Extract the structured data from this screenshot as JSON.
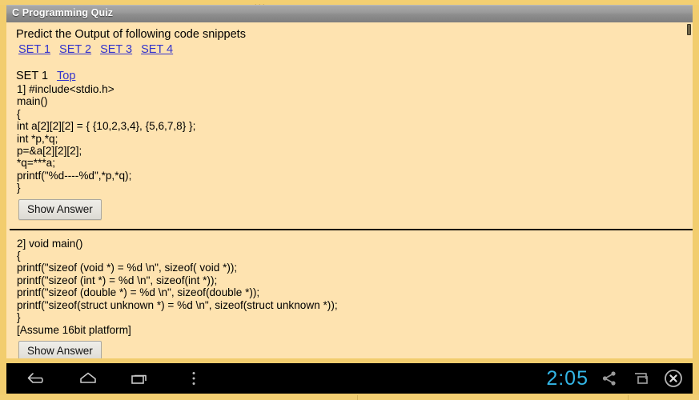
{
  "window": {
    "title": "C Programming Quiz"
  },
  "page": {
    "intro": "Predict the Output of following code snippets",
    "nav_links": [
      {
        "label": "SET 1"
      },
      {
        "label": "SET 2"
      },
      {
        "label": "SET 3"
      },
      {
        "label": "SET 4"
      }
    ],
    "sections": [
      {
        "heading": "SET 1",
        "top_link": "Top",
        "code": "1] #include<stdio.h>\nmain()\n{\nint a[2][2][2] = { {10,2,3,4}, {5,6,7,8} };\nint *p,*q;\np=&a[2][2][2];\n*q=***a;\nprintf(\"%d----%d\",*p,*q);\n}",
        "button_label": "Show Answer"
      },
      {
        "heading": "",
        "code": "2] void main()\n{\nprintf(\"sizeof (void *) = %d \\n\", sizeof( void *));\nprintf(\"sizeof (int *) = %d \\n\", sizeof(int *));\nprintf(\"sizeof (double *) = %d \\n\", sizeof(double *));\nprintf(\"sizeof(struct unknown *) = %d \\n\", sizeof(struct unknown *));\n}\n[Assume 16bit platform]",
        "button_label": "Show Answer"
      }
    ]
  },
  "navbar": {
    "clock": "2:05",
    "icons": {
      "back": "back-arrow-icon",
      "home": "home-icon",
      "recents": "recent-apps-icon",
      "menu": "overflow-menu-icon",
      "share": "share-icon",
      "restore": "restore-window-icon",
      "close": "close-circle-icon"
    }
  },
  "colors": {
    "page_background": "#fee3b0",
    "frame": "#f2cd6e",
    "link": "#3333cc",
    "clock": "#33b5e5",
    "titlebar_text": "#ffffff",
    "divider": "#151008"
  }
}
